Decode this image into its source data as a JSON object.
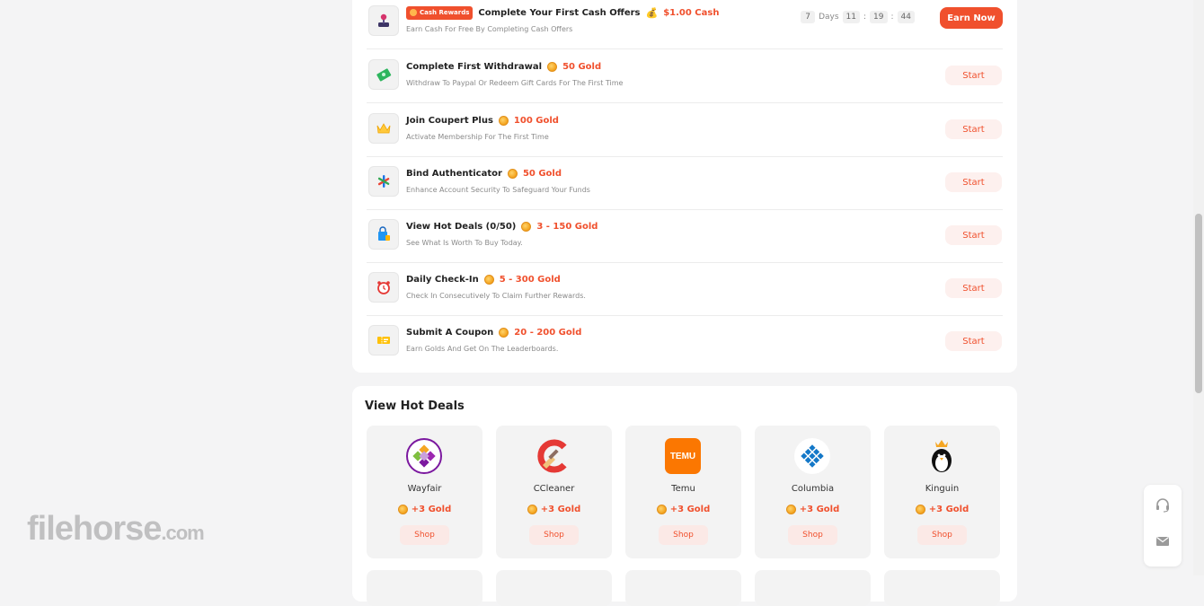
{
  "tasks": [
    {
      "icon": "joystick-icon",
      "badge": "Cash Rewards",
      "title": "Complete Your First Cash Offers",
      "reward": "$1.00 Cash",
      "desc": "Earn Cash For Free By Completing Cash Offers",
      "button": "Earn Now",
      "countdown": {
        "days": "7",
        "days_label": "Days",
        "hours": "11",
        "minutes": "19",
        "seconds": "44"
      }
    },
    {
      "icon": "money-icon",
      "title": "Complete First Withdrawal",
      "reward": "50 Gold",
      "desc": "Withdraw To Paypal Or Redeem Gift Cards For The First Time",
      "button": "Start"
    },
    {
      "icon": "crown-icon",
      "title": "Join Coupert Plus",
      "reward": "100 Gold",
      "desc": "Activate Membership For The First Time",
      "button": "Start"
    },
    {
      "icon": "authenticator-icon",
      "title": "Bind Authenticator",
      "reward": "50 Gold",
      "desc": "Enhance Account Security To Safeguard Your Funds",
      "button": "Start"
    },
    {
      "icon": "shopping-bag-icon",
      "title": "View Hot Deals (0/50)",
      "reward": "3 - 150 Gold",
      "desc": "See What Is Worth To Buy Today.",
      "button": "Start"
    },
    {
      "icon": "alarm-clock-icon",
      "title": "Daily Check-In",
      "reward": "5 - 300 Gold",
      "desc": "Check In Consecutively To Claim Further Rewards.",
      "button": "Start"
    },
    {
      "icon": "coupon-icon",
      "title": "Submit A Coupon",
      "reward": "20 - 200 Gold",
      "desc": "Earn Golds And Get On The Leaderboards.",
      "button": "Start"
    }
  ],
  "hot_deals": {
    "title": "View Hot Deals",
    "stores": [
      {
        "name": "Wayfair",
        "gold": "+3 Gold",
        "button": "Shop"
      },
      {
        "name": "CCleaner",
        "gold": "+3 Gold",
        "button": "Shop"
      },
      {
        "name": "Temu",
        "gold": "+3 Gold",
        "button": "Shop",
        "logo_text": "TEMU"
      },
      {
        "name": "Columbia",
        "gold": "+3 Gold",
        "button": "Shop"
      },
      {
        "name": "Kinguin",
        "gold": "+3 Gold",
        "button": "Shop"
      }
    ]
  },
  "watermark": {
    "brand": "filehorse",
    "suffix": ".com"
  },
  "colors": {
    "accent": "#f0502d",
    "gold": "#f3a21b"
  }
}
